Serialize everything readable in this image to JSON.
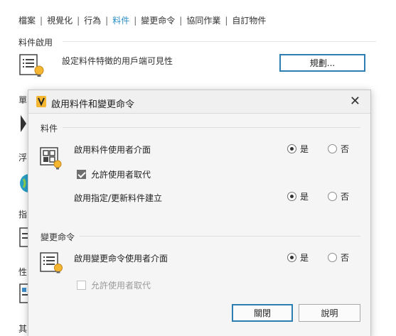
{
  "tabs": [
    {
      "label": "檔案",
      "active": false
    },
    {
      "label": "視覺化",
      "active": false
    },
    {
      "label": "行為",
      "active": false
    },
    {
      "label": "料件",
      "active": true
    },
    {
      "label": "變更命令",
      "active": false
    },
    {
      "label": "協同作業",
      "active": false
    },
    {
      "label": "自訂物件",
      "active": false
    }
  ],
  "tab_separator": "|",
  "background": {
    "section_title": "料件啟用",
    "row_text": "設定料件特徵的用戶端可見性",
    "plan_button": "規劃...",
    "side_labels": [
      "單",
      "浮",
      "指",
      "性",
      "其"
    ]
  },
  "dialog": {
    "title": "啟用料件和變更命令",
    "close_icon": "close-icon",
    "items_group": {
      "label": "料件",
      "enable_ui_label": "啟用料件使用者介面",
      "enable_ui_value": "是",
      "allow_override_label": "允許使用者取代",
      "allow_override_checked": true,
      "assign_update_label": "啟用指定/更新料件建立",
      "assign_update_value": "是"
    },
    "change_group": {
      "label": "變更命令",
      "enable_ui_label": "啟用變更命令使用者介面",
      "enable_ui_value": "是",
      "allow_override_label": "允許使用者取代",
      "allow_override_checked": false
    },
    "yes_label": "是",
    "no_label": "否",
    "close_button": "關閉",
    "help_button": "說明"
  },
  "colors": {
    "accent": "#2d7fb3",
    "active_tab": "#2a8ec4",
    "bulb": "#f5b731"
  }
}
